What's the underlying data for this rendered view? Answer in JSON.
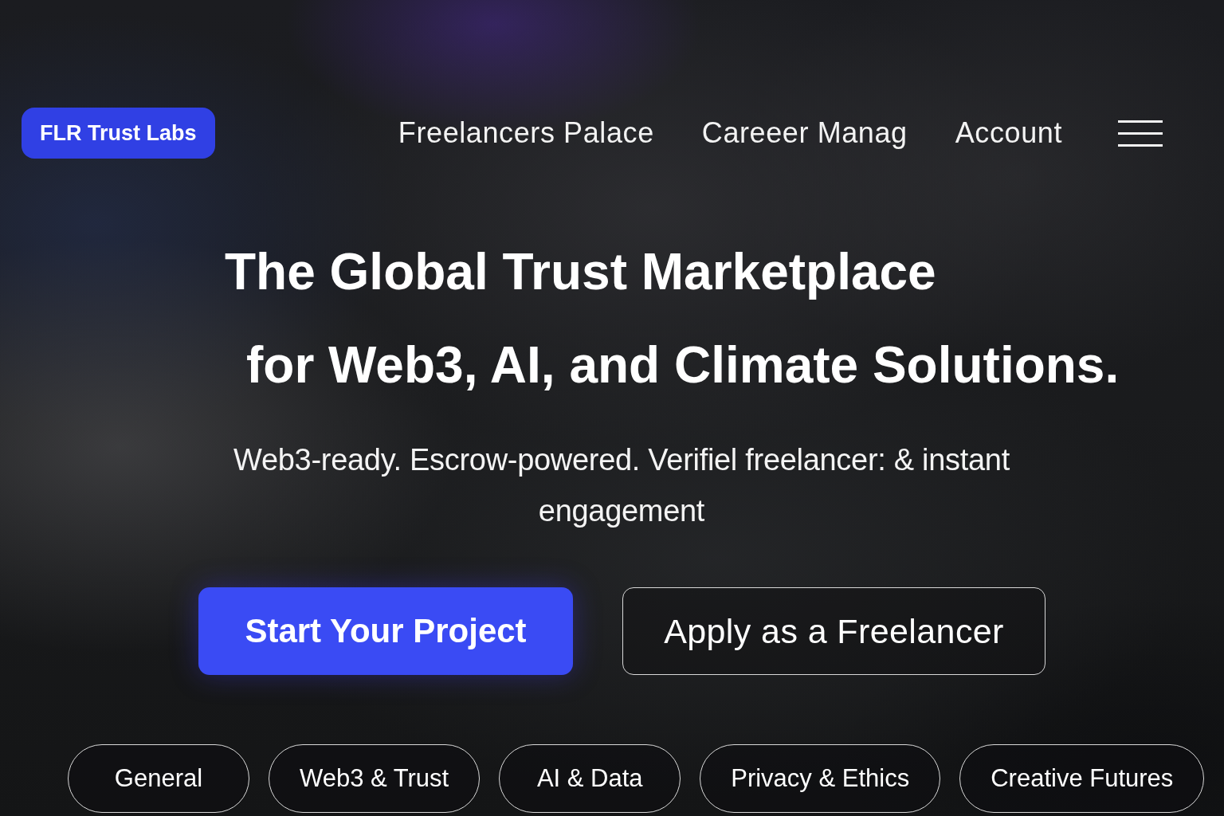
{
  "brand": {
    "label": "FLR Trust Labs"
  },
  "nav": {
    "links": [
      "Freelancers Palace",
      "Careeer Manag",
      "Account"
    ]
  },
  "hero": {
    "headline": [
      "The Global Trust Marketplace",
      "for Web3, AI, and Climate Solutions."
    ],
    "subtitle": "Web3-ready. Escrow-powered. Verifiel freelancer: & instant engagement"
  },
  "actions": [
    {
      "label": "Start Your Project",
      "kind": "primary"
    },
    {
      "label": "Apply as a Freelancer",
      "kind": "outline"
    }
  ],
  "categories": [
    {
      "label": "General"
    },
    {
      "label": "Web3 & Trust"
    },
    {
      "label": "AI & Data"
    },
    {
      "label": "Privacy & Ethics"
    },
    {
      "label": "Creative Futures"
    }
  ]
}
